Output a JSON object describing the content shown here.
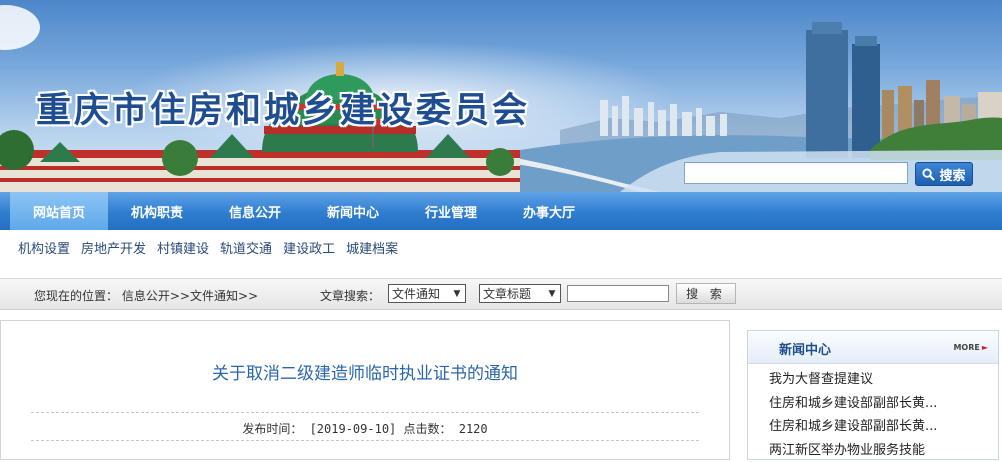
{
  "header": {
    "site_title": "重庆市住房和城乡建设委员会",
    "search_placeholder": "",
    "search_button": "搜索"
  },
  "main_nav": {
    "items": [
      {
        "label": "网站首页",
        "active": true
      },
      {
        "label": "机构职责",
        "active": false
      },
      {
        "label": "信息公开",
        "active": false
      },
      {
        "label": "新闻中心",
        "active": false
      },
      {
        "label": "行业管理",
        "active": false
      },
      {
        "label": "办事大厅",
        "active": false
      }
    ]
  },
  "sub_nav": {
    "items": [
      "机构设置",
      "房地产开发",
      "村镇建设",
      "轨道交通",
      "建设政工",
      "城建档案"
    ]
  },
  "location_bar": {
    "prefix": "您现在的位置：",
    "crumb_1": "信息公开",
    "sep_1": ">>",
    "crumb_2": "文件通知",
    "sep_2": ">>",
    "search_label": "文章搜索：",
    "category_select": "文件通知",
    "field_select": "文章标题",
    "keyword_value": "",
    "search_button": "搜 索"
  },
  "article": {
    "title": "关于取消二级建造师临时执业证书的通知",
    "meta": "发布时间： [2019-09-10] 点击数： 2120"
  },
  "news_panel": {
    "title": "新闻中心",
    "more": "MORE",
    "items": [
      "我为大督查提建议",
      "住房和城乡建设部副部长黄...",
      "住房和城乡建设部副部长黄...",
      "两江新区举办物业服务技能"
    ]
  },
  "colors": {
    "nav_blue": "#2f7dd0",
    "nav_active": "#7fbcf0",
    "title_blue": "#2a66ad",
    "banner_title": "#1f4d91",
    "more_arrow": "#c0262d"
  },
  "icons": [
    "search-icon",
    "more-arrow-icon",
    "select-arrow-icon"
  ]
}
